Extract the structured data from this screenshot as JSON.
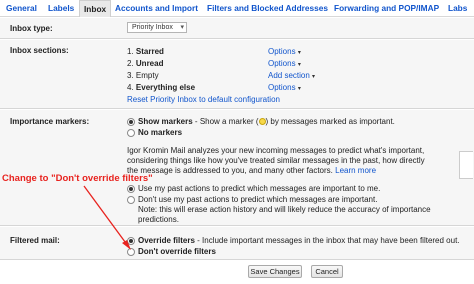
{
  "tabs": [
    {
      "label": "General"
    },
    {
      "label": "Labels"
    },
    {
      "label": "Inbox"
    },
    {
      "label": "Accounts and Import"
    },
    {
      "label": "Filters and Blocked Addresses"
    },
    {
      "label": "Forwarding and POP/IMAP"
    },
    {
      "label": "Labs"
    }
  ],
  "inbox_type": {
    "label": "Inbox type:",
    "select_value": "Priority Inbox",
    "select_arrow": "▾"
  },
  "inbox_sections": {
    "label": "Inbox sections:",
    "items": [
      {
        "num": "1.",
        "name": "Starred",
        "option": "Options"
      },
      {
        "num": "2.",
        "name": "Unread",
        "option": "Options"
      },
      {
        "num": "3.",
        "name": "Empty",
        "option": "Add section"
      },
      {
        "num": "4.",
        "name": "Everything else",
        "option": "Options"
      }
    ],
    "caret": "▾",
    "reset_link": "Reset Priority Inbox to default configuration"
  },
  "importance_markers": {
    "label": "Importance markers:",
    "show_markers_bold": "Show markers",
    "show_markers_rest_a": " - Show a marker (",
    "show_markers_rest_b": ") by messages marked as important.",
    "no_markers": "No markers",
    "desc_lines": [
      "Igor Kromin Mail analyzes your new incoming messages to predict what's important,",
      "considering things like how you've treated similar messages in the past, how directly",
      "the message is addressed to you, and many other factors."
    ],
    "learn_more": "Learn more",
    "use_past": "Use my past actions to predict which messages are important to me.",
    "dont_use_past_lines": [
      "Don't use my past actions to predict which messages are important.",
      "Note: this will erase action history and will likely reduce the accuracy of importance",
      "predictions."
    ]
  },
  "annotation": {
    "callout": "Change to \"Don't override filters\"",
    "color": "#e8231f"
  },
  "filtered_mail": {
    "label": "Filtered mail:",
    "override_bold": "Override filters",
    "override_rest": " - Include important messages in the inbox that may have been filtered out.",
    "dont_override": "Don't override filters"
  },
  "buttons": {
    "save": "Save Changes",
    "cancel": "Cancel"
  },
  "colors": {
    "link": "#1155cc",
    "row_bg": "#f6f6f6",
    "marker": "#f7d84a"
  }
}
